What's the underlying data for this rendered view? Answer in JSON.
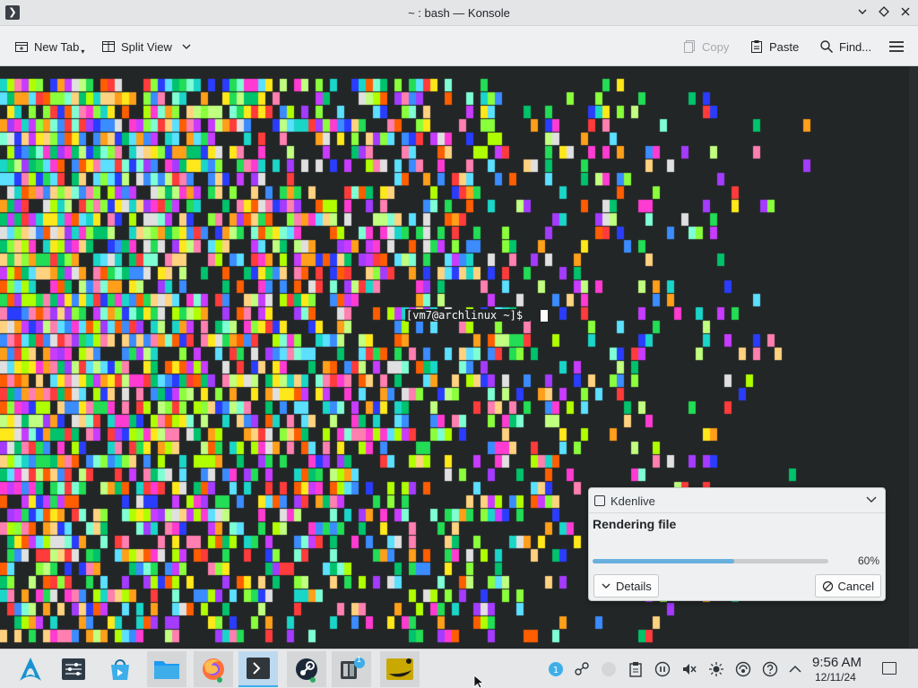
{
  "window": {
    "title": "~ : bash — Konsole",
    "icon": "terminal-icon"
  },
  "toolbar": {
    "new_tab": "New Tab",
    "split_view": "Split View",
    "copy": "Copy",
    "paste": "Paste",
    "find": "Find...",
    "icons": [
      "new-tab-icon",
      "split-view-icon",
      "copy-icon",
      "paste-icon",
      "search-icon",
      "hamburger-menu-icon"
    ]
  },
  "terminal": {
    "prompt": "[vm7@archlinux ~]$ ",
    "background": "#232627",
    "foreground": "#fcfcfc"
  },
  "notification": {
    "app": "Kdenlive",
    "title": "Rendering file",
    "progress_value": 0.6,
    "progress_text": "60%",
    "details": "Details",
    "cancel": "Cancel",
    "accent": "#6ab0de"
  },
  "taskbar": {
    "apps": [
      "arch-linux-launcher-icon",
      "system-settings-icon",
      "discover-icon",
      "dolphin-icon",
      "firefox-icon",
      "konsole-icon",
      "steam-icon",
      "kdenlive-icon",
      "media-player-icon"
    ],
    "tray": [
      "updates-badge-icon",
      "kde-connect-icon",
      "network-icon",
      "clipboard-icon",
      "media-pause-icon",
      "volume-muted-icon",
      "brightness-icon",
      "vpn-icon",
      "help-icon",
      "expand-tray-icon"
    ],
    "updates_badge": "1",
    "clock_time": "9:56 AM",
    "clock_date": "12/11/24"
  }
}
